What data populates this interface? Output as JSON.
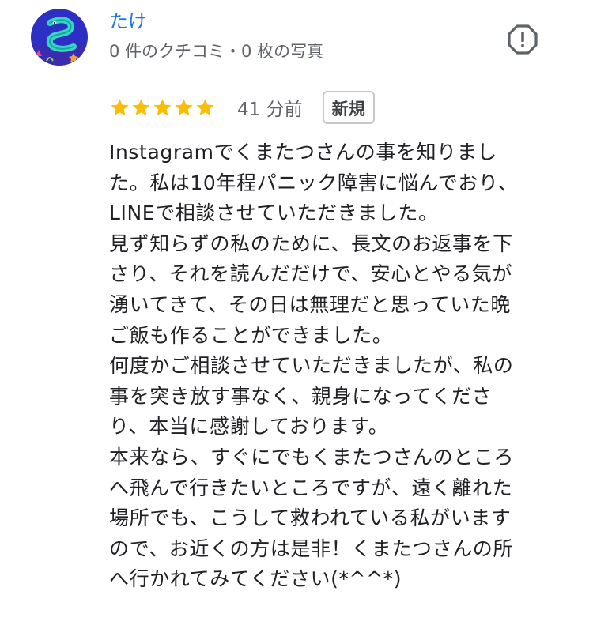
{
  "author": {
    "name": "たけ",
    "meta": "0 件のクチコミ・0 枚の写真",
    "avatar_icon": "eel-avatar-icon"
  },
  "report": {
    "icon": "report-flag-icon"
  },
  "rating": {
    "stars": 5,
    "max_stars": 5,
    "star_color": "#fbbc04",
    "time": "41 分前",
    "badge": "新規"
  },
  "review": {
    "lines": [
      "Instagramでくまたつさんの事を知りまし",
      "た。私は10年程パニック障害に悩んでおり、",
      "LINEで相談させていただきました。",
      "見ず知らずの私のために、長文のお返事を下",
      "さり、それを読んだだけで、安心とやる気が",
      "湧いてきて、その日は無理だと思っていた晩",
      "ご飯も作ることができました。",
      "何度かご相談させていただきましたが、私の",
      "事を突き放す事なく、親身になってくださ",
      "り、本当に感謝しております。",
      "本来なら、すぐにでもくまたつさんのところ",
      "へ飛んで行きたいところですが、遠く離れた",
      "場所でも、こうして救われている私がいます",
      "ので、お近くの方は是非！くまたつさんの所",
      "へ行かれてみてください(*^^*)"
    ]
  },
  "colors": {
    "link": "#1a73e8",
    "secondary_text": "#5f6368",
    "avatar_bg": "#2d2fc4"
  }
}
